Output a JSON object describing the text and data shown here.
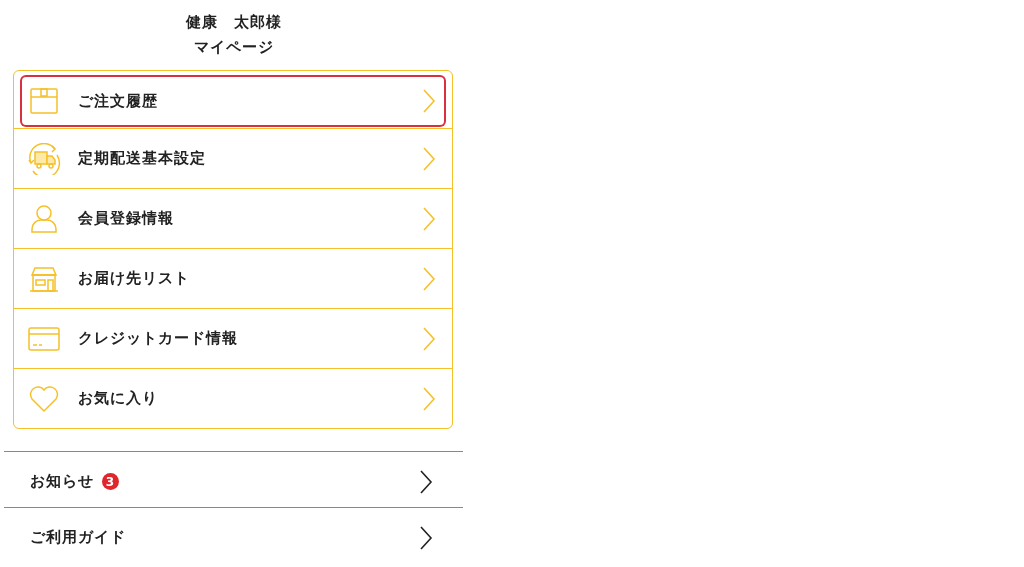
{
  "header": {
    "name": "健康　太郎様",
    "title": "マイページ"
  },
  "menu": [
    {
      "label": "ご注文履歴",
      "selected": true
    },
    {
      "label": "定期配送基本設定",
      "selected": false
    },
    {
      "label": "会員登録情報",
      "selected": false
    },
    {
      "label": "お届け先リスト",
      "selected": false
    },
    {
      "label": "クレジットカード情報",
      "selected": false
    },
    {
      "label": "お気に入り",
      "selected": false
    }
  ],
  "links": [
    {
      "label": "お知らせ",
      "badge": "3"
    },
    {
      "label": "ご利用ガイド"
    }
  ]
}
